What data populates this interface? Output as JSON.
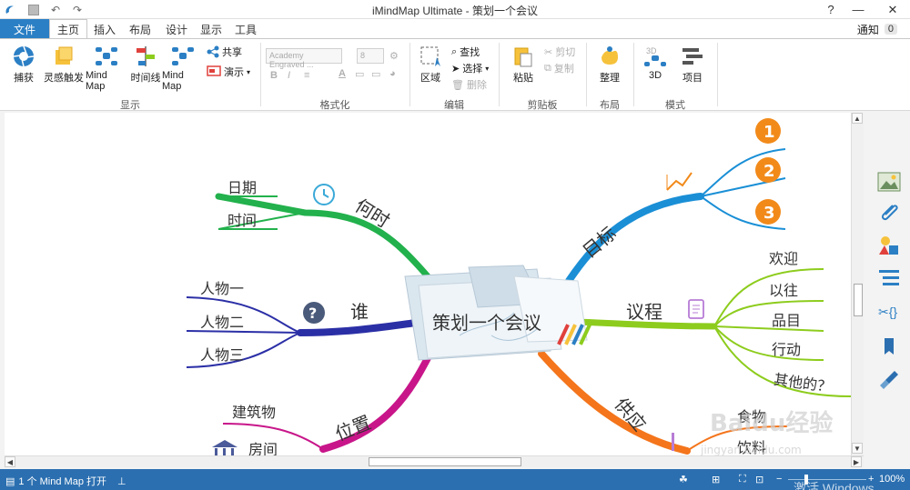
{
  "window": {
    "title": "iMindMap Ultimate - 策划一个会议",
    "help": "?",
    "minimize": "—",
    "close": "✕"
  },
  "tabs": [
    "文件",
    "主页",
    "插入",
    "布局",
    "设计",
    "显示",
    "工具"
  ],
  "notify": {
    "label": "通知",
    "count": "0"
  },
  "ribbon": {
    "display_group": {
      "label": "显示",
      "buttons": [
        "捕获",
        "灵感触发",
        "Mind Map",
        "时间线",
        "Mind Map"
      ],
      "share": "共享",
      "present": "演示"
    },
    "format_group": {
      "label": "格式化",
      "font": "Academy Engraved ...",
      "size": "8",
      "bold": "B",
      "italic": "I",
      "underline": "U"
    },
    "edit_group": {
      "label": "编辑",
      "area": "区域",
      "find": "查找",
      "select": "选择",
      "delete": "删除"
    },
    "clipboard_group": {
      "label": "剪贴板",
      "paste": "粘贴",
      "cut": "剪切",
      "copy": "复制"
    },
    "layout_group": {
      "label": "布局",
      "tidy": "整理"
    },
    "mode_group": {
      "label": "模式",
      "threeD": "3D",
      "project": "项目",
      "badge3d": "3D"
    }
  },
  "mindmap": {
    "central": "策划一个会议",
    "branches": {
      "when": {
        "label": "何时",
        "children": [
          "日期",
          "时间"
        ]
      },
      "who": {
        "label": "谁",
        "children": [
          "人物一",
          "人物二",
          "人物三"
        ]
      },
      "where": {
        "label": "位置",
        "children": [
          "建筑物",
          "房间"
        ]
      },
      "goals": {
        "label": "目标",
        "children": [
          "1",
          "2",
          "3"
        ]
      },
      "agenda": {
        "label": "议程",
        "children": [
          "欢迎",
          "以往",
          "品目",
          "行动",
          "其他的？"
        ]
      },
      "supply": {
        "label": "供应",
        "children": [
          "食物",
          "饮料"
        ]
      }
    },
    "colors": {
      "when": "#22b14c",
      "who": "#2b2fa6",
      "where": "#c8168a",
      "goals": "#1a8fd6",
      "agenda": "#8dcc1d",
      "supply": "#f4751b",
      "goal_badge": "#f28a1a"
    }
  },
  "status": {
    "maps_open": "1 个 Mind Map 打开",
    "zoom": "100%"
  },
  "watermark": {
    "baidu": "Baidu经验",
    "url": "jingyan.baidu.com",
    "activate": "激活 Windows"
  }
}
